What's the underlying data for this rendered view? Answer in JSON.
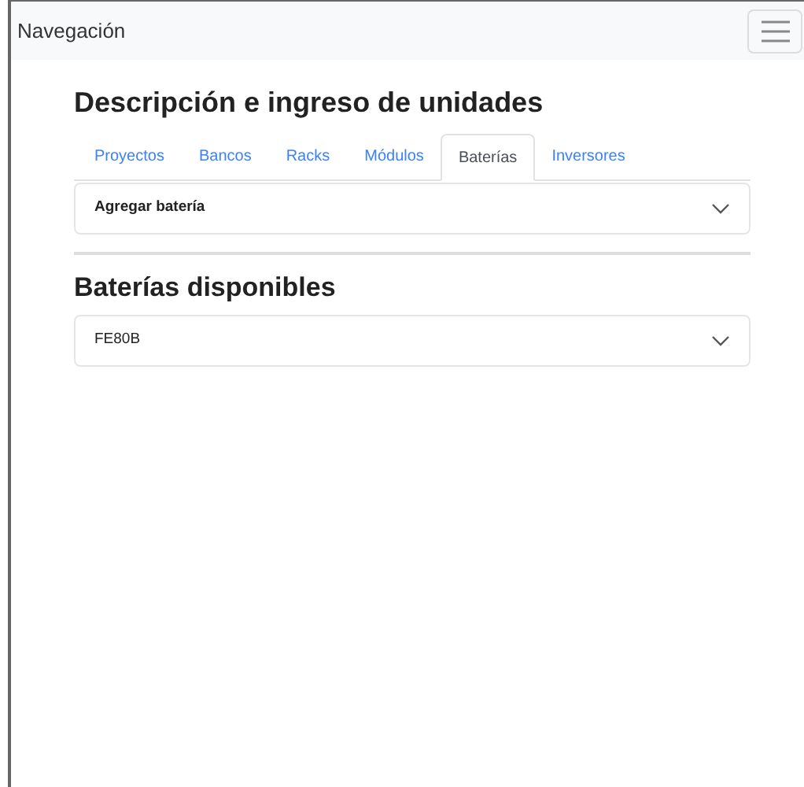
{
  "navbar": {
    "brand": "Navegación"
  },
  "heading": "Descripción e ingreso de unidades",
  "tabs": [
    {
      "label": "Proyectos",
      "selected": false
    },
    {
      "label": "Bancos",
      "selected": false
    },
    {
      "label": "Racks",
      "selected": false
    },
    {
      "label": "Módulos",
      "selected": false
    },
    {
      "label": "Baterías",
      "selected": true
    },
    {
      "label": "Inversores",
      "selected": false
    }
  ],
  "add_panel": {
    "title": "Agregar batería",
    "expanded": false
  },
  "list_heading": "Baterías disponibles",
  "batteries": [
    {
      "name": "FE80B",
      "expanded": false
    }
  ]
}
